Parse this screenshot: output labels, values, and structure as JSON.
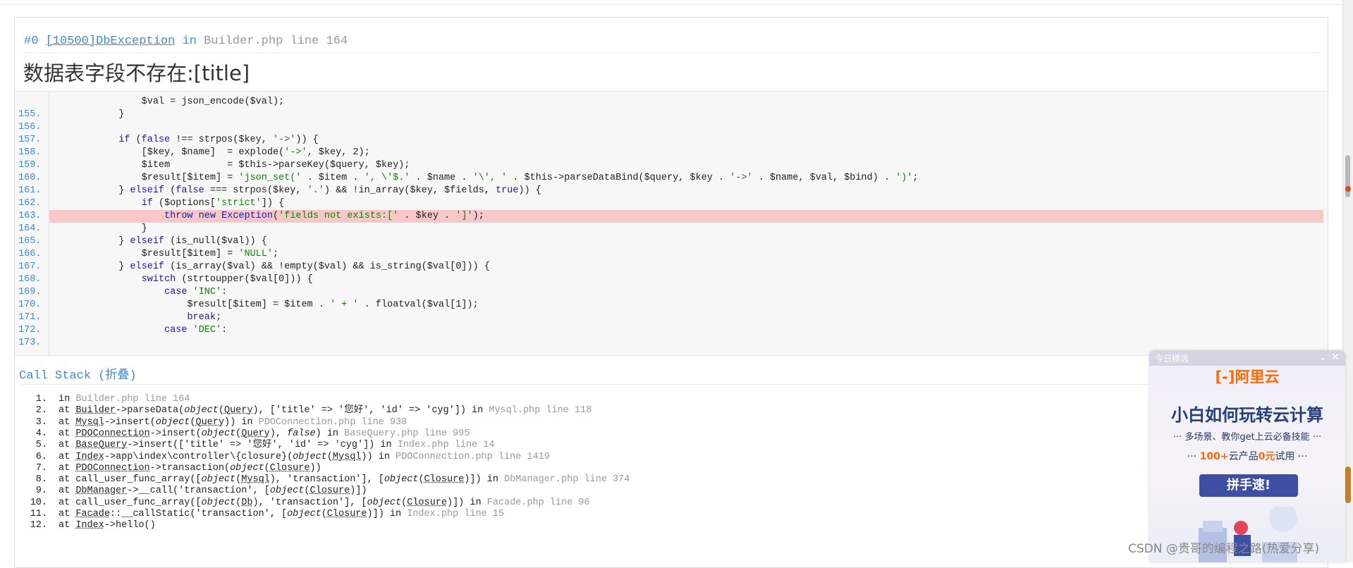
{
  "exception": {
    "index": "#0",
    "code_class": "[10500]DbException",
    "in": "in",
    "file": "Builder.php line 164",
    "message": "数据表字段不存在:[title]"
  },
  "source_lines": [
    {
      "no": "",
      "code": "                $val = json_encode($val);"
    },
    {
      "no": "155.",
      "code": "            }"
    },
    {
      "no": "156.",
      "code": ""
    },
    {
      "no": "157.",
      "code": "            if (false !== strpos($key, '->')) {"
    },
    {
      "no": "158.",
      "code": "                [$key, $name]  = explode('->', $key, 2);"
    },
    {
      "no": "159.",
      "code": "                $item          = $this->parseKey($query, $key);"
    },
    {
      "no": "160.",
      "code": "                $result[$item] = 'json_set(' . $item . ', \\'$.' . $name . '\\', ' . $this->parseDataBind($query, $key . '->' . $name, $val, $bind) . ')';"
    },
    {
      "no": "161.",
      "code": "            } elseif (false === strpos($key, '.') && !in_array($key, $fields, true)) {"
    },
    {
      "no": "162.",
      "code": "                if ($options['strict']) {"
    },
    {
      "no": "163.",
      "code": "                    throw new Exception('fields not exists:[' . $key . ']');"
    },
    {
      "no": "164.",
      "code": "                }"
    },
    {
      "no": "165.",
      "code": "            } elseif (is_null($val)) {"
    },
    {
      "no": "166.",
      "code": "                $result[$item] = 'NULL';"
    },
    {
      "no": "167.",
      "code": "            } elseif (is_array($val) && !empty($val) && is_string($val[0])) {"
    },
    {
      "no": "168.",
      "code": "                switch (strtoupper($val[0])) {"
    },
    {
      "no": "169.",
      "code": "                    case 'INC':"
    },
    {
      "no": "170.",
      "code": "                        $result[$item] = $item . ' + ' . floatval($val[1]);"
    },
    {
      "no": "171.",
      "code": "                        break;"
    },
    {
      "no": "172.",
      "code": "                    case 'DEC':"
    },
    {
      "no": "173.",
      "code": ""
    }
  ],
  "highlight_line": "163.",
  "call_stack": {
    "title": "Call Stack (折叠)",
    "items": [
      {
        "n": "1.",
        "text": "in ",
        "file": "Builder.php line 164"
      },
      {
        "n": "2.",
        "text": "at Builder->parseData(object(Query), ['title' => '您好', 'id' => 'cyg']) in ",
        "file": "Mysql.php line 118"
      },
      {
        "n": "3.",
        "text": "at Mysql->insert(object(Query)) in ",
        "file": "PDOConnection.php line 938"
      },
      {
        "n": "4.",
        "text": "at PDOConnection->insert(object(Query), false) in ",
        "file": "BaseQuery.php line 995"
      },
      {
        "n": "5.",
        "text": "at BaseQuery->insert(['title' => '您好', 'id' => 'cyg']) in ",
        "file": "Index.php line 14"
      },
      {
        "n": "6.",
        "text": "at Index->app\\index\\controller\\{closure}(object(Mysql)) in ",
        "file": "PDOConnection.php line 1419"
      },
      {
        "n": "7.",
        "text": "at PDOConnection->transaction(object(Closure))",
        "file": ""
      },
      {
        "n": "8.",
        "text": "at call_user_func_array([object(Mysql), 'transaction'], [object(Closure)]) in ",
        "file": "DbManager.php line 374"
      },
      {
        "n": "9.",
        "text": "at DbManager->__call('transaction', [object(Closure)])",
        "file": ""
      },
      {
        "n": "10.",
        "text": "at call_user_func_array([object(Db), 'transaction'], [object(Closure)]) in ",
        "file": "Facade.php line 96"
      },
      {
        "n": "11.",
        "text": "at Facade::__callStatic('transaction', [object(Closure)]) in ",
        "file": "Index.php line 15"
      },
      {
        "n": "12.",
        "text": "at Index->hello()",
        "file": ""
      }
    ]
  },
  "ad": {
    "tag": "今日精选",
    "brand": "[-]阿里云",
    "title": "小白如何玩转云计算",
    "sub1": "··· 多场景、教你get上云必备技能 ···",
    "sub2_prefix": "··· ",
    "sub2_orange": "100+",
    "sub2_mid": "云产品",
    "sub2_orange2": "0元",
    "sub2_suffix": "试用 ···",
    "button": "拼手速!",
    "ctl_collapse": "⌄",
    "ctl_close": "✕"
  },
  "watermark": "CSDN @贵哥的编程之路(热爱分享)",
  "colors": {
    "link_blue": "#4288ce",
    "highlight": "#f8c8c8",
    "brand_orange": "#ff6a00",
    "ad_title": "#24407c"
  }
}
